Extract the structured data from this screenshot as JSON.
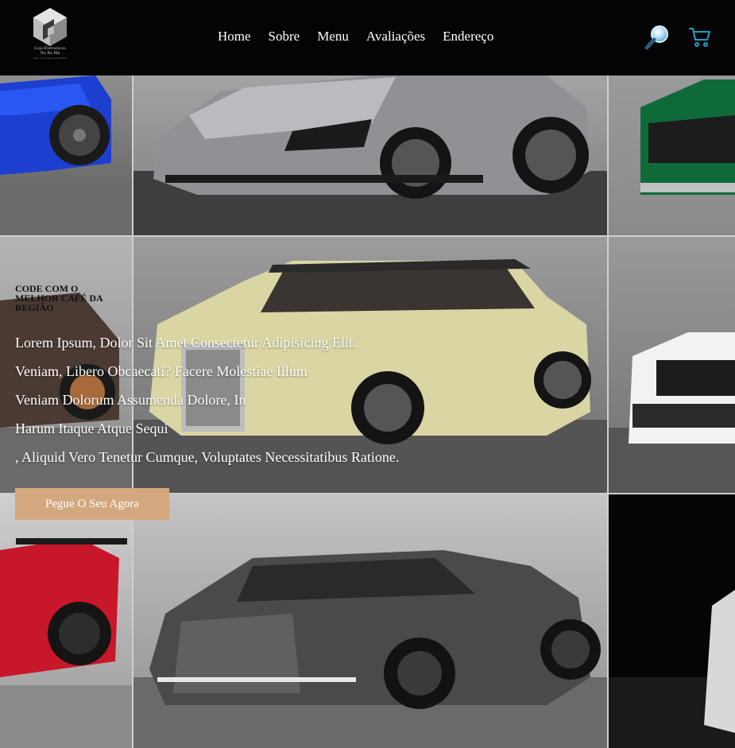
{
  "brand": {
    "logo_icon": "cube-icon",
    "name_line1": "Loja Eletronicos",
    "name_line2": "Nu Ba Ma",
    "tagline": "aqui, a tecnologia pode mudar"
  },
  "nav": {
    "items": [
      {
        "label": "Home"
      },
      {
        "label": "Sobre"
      },
      {
        "label": "Menu"
      },
      {
        "label": "Avaliações"
      },
      {
        "label": "Endereço"
      }
    ]
  },
  "header_icons": {
    "search": "search-icon",
    "cart": "cart-icon"
  },
  "hero": {
    "eyebrow": "CODE COM O MELHOR CAFÉ DA REGIÃO",
    "lines": [
      "Lorem Ipsum, Dolor Sit Amet Consectetur Adipisicing Elit.",
      "Veniam, Libero Obcaecati? Facere Molestiae Illum",
      "Veniam Dolorum Assumenda Dolore, In",
      "Harum Itaque Atque Sequi",
      ", Aliquid Vero Tenetur Cumque, Voluptates Necessitatibus Ratione."
    ],
    "cta_label": "Pegue O Seu Agora"
  },
  "colors": {
    "header_bg": "#040404",
    "cta_bg": "#d3a87e",
    "cart_icon": "#1aa3c8"
  }
}
